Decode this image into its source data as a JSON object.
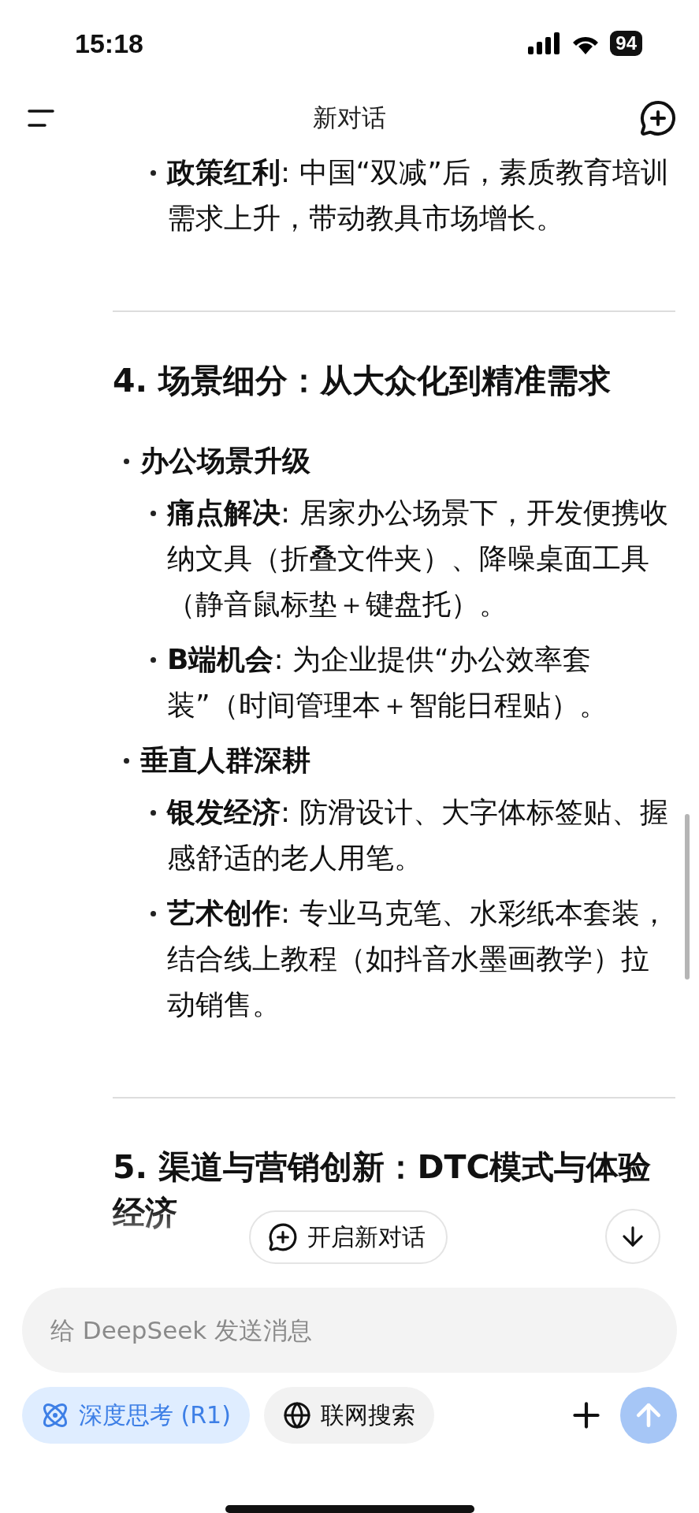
{
  "status_bar": {
    "time": "15:18",
    "battery": "94"
  },
  "header": {
    "title": "新对话"
  },
  "blocks": [
    {
      "kind": "sublist",
      "items": [
        {
          "text": "**政策红利**: 中国“双减”后，素质教育培训需求上升，带动教具市场增长。"
        }
      ]
    },
    {
      "kind": "rule"
    },
    {
      "kind": "heading",
      "text": "4. 场景细分：从大众化到精准需求"
    },
    {
      "kind": "list",
      "items": [
        {
          "text": "办公场景升级",
          "children": [
            {
              "text": "**痛点解决**: 居家办公场景下，开发便携收纳文具（折叠文件夹）、降噪桌面工具（静音鼠标垫＋键盘托）。"
            },
            {
              "text": "**B端机会**: 为企业提供“办公效率套装”（时间管理本＋智能日程贴）。"
            }
          ]
        },
        {
          "text": "垂直人群深耕",
          "children": [
            {
              "text": "**银发经济**: 防滑设计、大字体标签贴、握感舒适的老人用笔。"
            },
            {
              "text": "**艺术创作**: 专业马克笔、水彩纸本套装，结合线上教程（如抖音水墨画教学）拉动销售。"
            }
          ]
        }
      ]
    },
    {
      "kind": "rule"
    },
    {
      "kind": "heading",
      "text": "5. 渠道与营销创新：DTC模式与体验经济"
    }
  ],
  "new_chat_button": {
    "label": "开启新对话"
  },
  "composer": {
    "placeholder": "给 DeepSeek 发送消息",
    "toggles": [
      {
        "kind": "think",
        "label": "深度思考 (R1)",
        "selected": true
      },
      {
        "kind": "search",
        "label": "联网搜索",
        "selected": false
      }
    ],
    "send_button": {
      "disabled": true
    }
  }
}
